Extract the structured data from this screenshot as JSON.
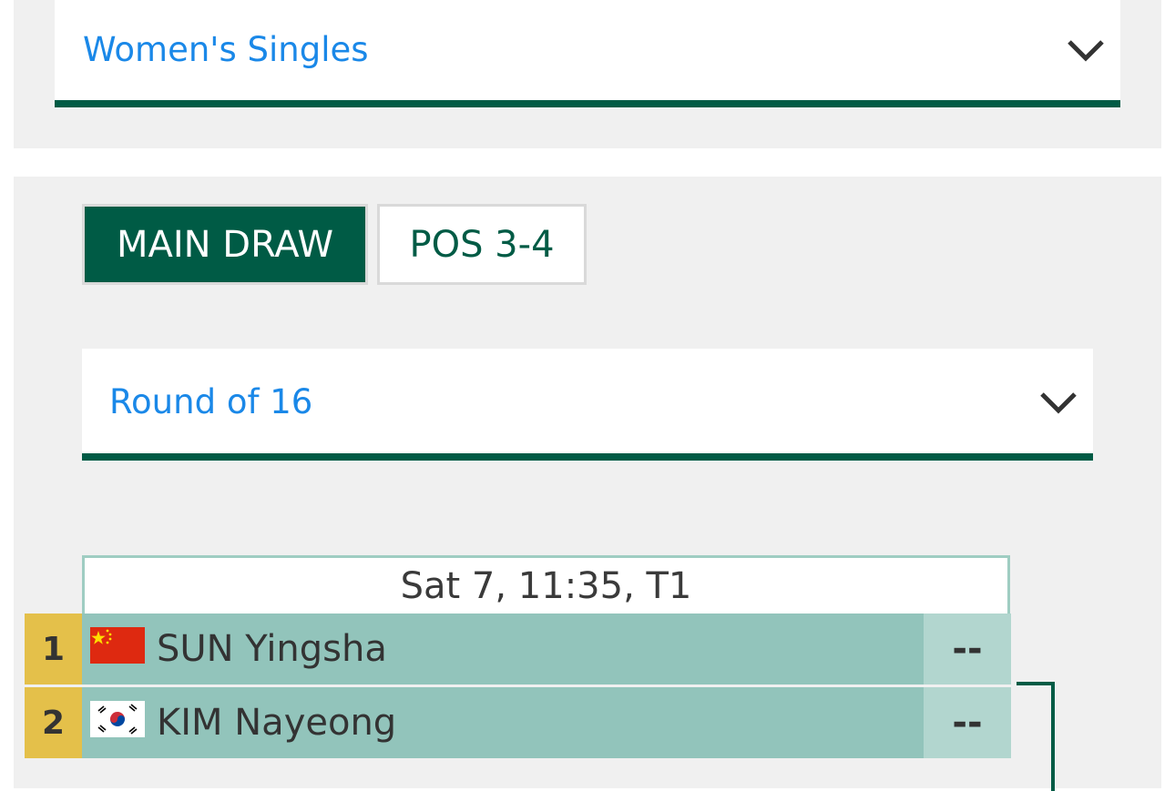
{
  "event_select": {
    "label": "Women's Singles",
    "icon": "chevron-down-icon"
  },
  "tabs": [
    {
      "label": "MAIN DRAW",
      "active": true
    },
    {
      "label": "POS 3-4",
      "active": false
    }
  ],
  "round_select": {
    "label": "Round of 16",
    "icon": "chevron-down-icon"
  },
  "match": {
    "header": "Sat 7, 11:35, T1",
    "players": [
      {
        "seed": "1",
        "flag": "china-flag-icon",
        "name": "SUN Yingsha",
        "score": "--"
      },
      {
        "seed": "2",
        "flag": "korea-flag-icon",
        "name": "KIM Nayeong",
        "score": "--"
      }
    ]
  },
  "colors": {
    "accent": "#005b45",
    "link": "#1a88e8",
    "seed_bg": "#e4c04a",
    "player_bg": "#92c4bb",
    "score_bg": "#b2d6cf"
  }
}
